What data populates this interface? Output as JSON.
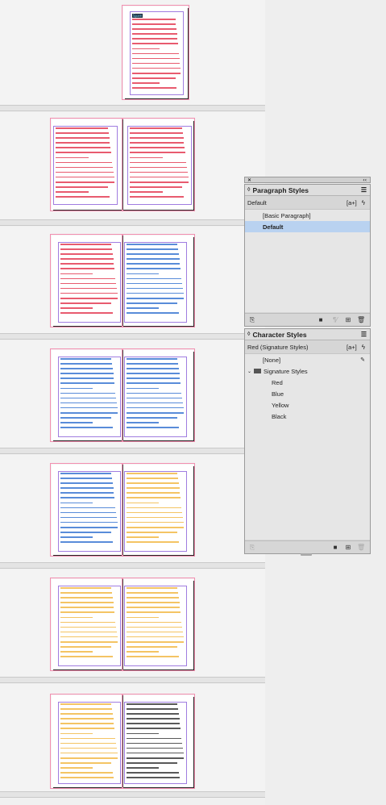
{
  "paragraph_styles": {
    "title": "Paragraph Styles",
    "current": "Default",
    "new_style_icon": "[a+]",
    "items": [
      "[Basic Paragraph]",
      "Default"
    ],
    "selected_index": 1
  },
  "character_styles": {
    "title": "Character Styles",
    "current": "Red (Signature Styles)",
    "new_style_icon": "[a+]",
    "none_label": "[None]",
    "group_label": "Signature Styles",
    "items": [
      "Red",
      "Blue",
      "Yellow",
      "Black"
    ]
  },
  "icons": {
    "panel_close": "close-icon",
    "panel_collapse": "double-chevron-icon",
    "panel_menu": "hamburger-menu-icon",
    "lightning": "quick-apply-icon",
    "folder": "folder-icon",
    "new": "new-style-icon",
    "trash": "trash-icon",
    "clear": "clear-overrides-icon"
  },
  "colors": {
    "selection": "#b9d2f0",
    "text_red": "#e0243f",
    "text_blue": "#2266cc",
    "text_yellow": "#f0b030",
    "text_black": "#222222",
    "bleed": "#f28fb0",
    "margin": "#a07de0"
  },
  "spreads": {
    "first_page_heading_highlight": "Spam",
    "page1_text": [
      "Spero ptaestium",
      "Elenisit ma del ipsam etur alit",
      "quam quatium aant, simolor aut",
      "bus in atem faccum coset quos que",
      "etiacil acit, tem omnetus dolo don",
      "doluptaquatis venimolupitat landi",
      "cnemi soluptia spera ma dolupt",
      "tum voluptur moloria volupta,",
      "tam. Buit eum de nonsentoli dis ta",
      "comnien explaborat accatem as quo",
      "pore dest, to blabo. Et doloreper",
      "tum fuga. Sumque consed esn",
      "empia cum re, officiur re idellab."
    ]
  }
}
